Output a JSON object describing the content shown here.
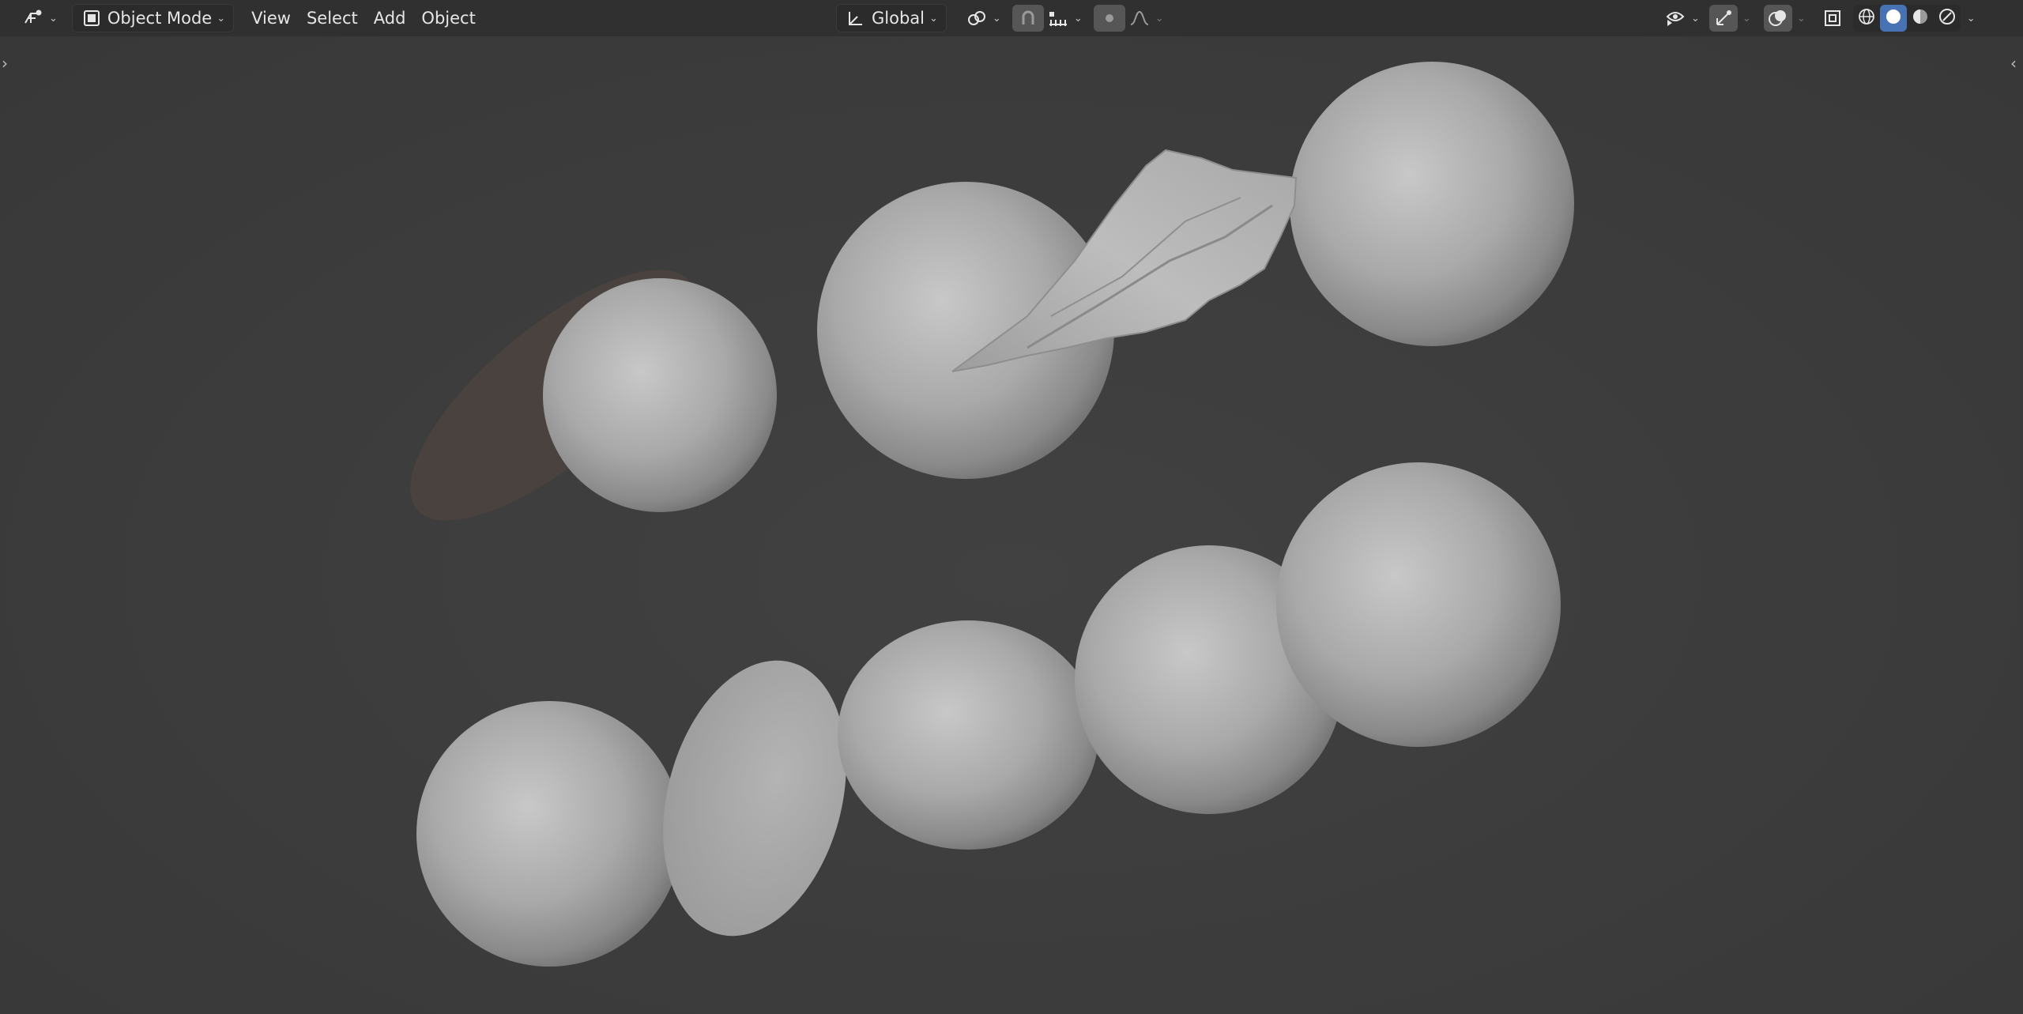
{
  "header": {
    "editor_type_icon": "viewport-3d-icon",
    "mode": {
      "label": "Object Mode",
      "icon": "object-mode-icon"
    },
    "menus": [
      "View",
      "Select",
      "Add",
      "Object"
    ],
    "transform_orientation": {
      "label": "Global",
      "icon": "orientation-axes-icon"
    },
    "pivot_icon": "pivot-link-icon",
    "snap_icon": "magnet-icon",
    "snap_target_icon": "snap-increment-icon",
    "proportional_icon": "proportional-edit-icon",
    "falloff_icon": "falloff-curve-icon",
    "visibility_icon": "eye-select-icon",
    "gizmo_icon": "gizmo-icon",
    "overlay_icon": "overlay-icon",
    "xray_icon": "xray-icon",
    "shading_modes": [
      "wireframe",
      "solid",
      "material-preview",
      "rendered"
    ],
    "active_shading": "solid"
  },
  "colors": {
    "header_bg": "#303030",
    "viewport_bg": "#3d3d3d",
    "accent": "#4772b3",
    "mesh": "#a8a8a8",
    "ring": "#4a423e"
  }
}
